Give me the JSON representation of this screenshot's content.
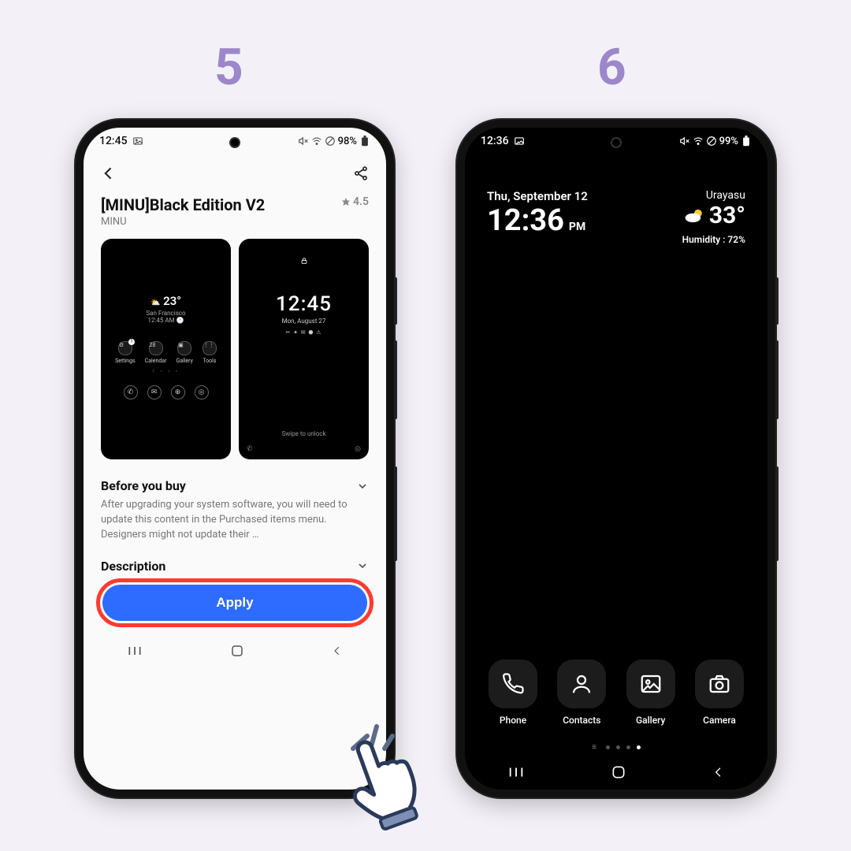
{
  "steps": {
    "left": "5",
    "right": "6"
  },
  "phoneA": {
    "status": {
      "time": "12:45",
      "battery": "98%"
    },
    "theme": {
      "title": "[MINU]Black Edition V2",
      "author": "MINU",
      "rating": "4.5"
    },
    "preview1": {
      "temp": "23°",
      "location": "San Francisco",
      "subtime": "12:45 AM",
      "icons": [
        "Settings",
        "Calendar",
        "Gallery",
        "Tools"
      ]
    },
    "preview2": {
      "time": "12:45",
      "date": "Mon, August 27",
      "swipe": "Swipe to unlock"
    },
    "sections": {
      "beforeTitle": "Before you buy",
      "beforeBody": "After upgrading your system software, you will need to update this content in the Purchased items menu. Designers might not update their …",
      "descTitle": "Description"
    },
    "apply": "Apply"
  },
  "phoneB": {
    "status": {
      "time": "12:36",
      "battery": "99%"
    },
    "widget": {
      "date": "Thu, September 12",
      "time": "12:36",
      "meridiem": "PM",
      "location": "Urayasu",
      "temp": "33°",
      "humidity": "Humidity : 72%"
    },
    "dock": [
      "Phone",
      "Contacts",
      "Gallery",
      "Camera"
    ]
  }
}
